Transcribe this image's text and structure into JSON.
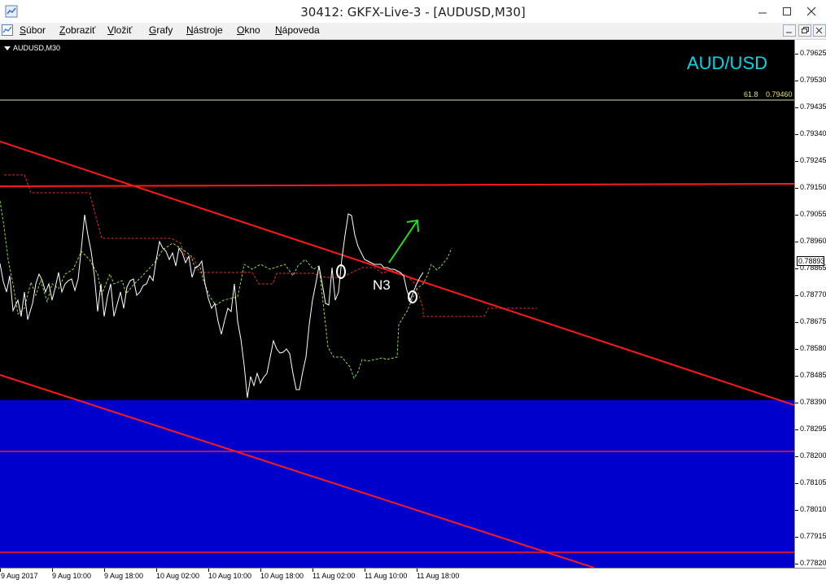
{
  "window": {
    "title": "30412: GKFX-Live-3 - [AUDUSD,M30]"
  },
  "menu": {
    "items": [
      {
        "ul": "S",
        "rest": "úbor"
      },
      {
        "ul": "Z",
        "rest": "obraziť"
      },
      {
        "ul": "V",
        "rest": "ložiť"
      },
      {
        "ul": "G",
        "rest": "rafy"
      },
      {
        "ul": "N",
        "rest": "ástroje"
      },
      {
        "ul": "O",
        "rest": "kno"
      },
      {
        "ul": "N",
        "rest": "ápoveda"
      }
    ]
  },
  "chart": {
    "symbol_label": "AUDUSD,M30",
    "pair_label": "AUD/USD",
    "fib_level": "61.8",
    "fib_price": "0.79460",
    "annotation": "N3",
    "current_price": "0.78893",
    "colors": {
      "background": "#000000",
      "trendline": "#ff1a1a",
      "zone": "#0000cc",
      "price_line": "#ffffff",
      "dashed_green": "#8fd84a",
      "dashed_red": "#e03030",
      "arrow": "#22dd22",
      "fib_line": "#d8d8a0",
      "pair_label": "#00d8e8"
    }
  },
  "price_axis": {
    "labels": [
      "0.79625",
      "0.79530",
      "0.79435",
      "0.79340",
      "0.79245",
      "0.79150",
      "0.79055",
      "0.78960",
      "0.78865",
      "0.78770",
      "0.78675",
      "0.78580",
      "0.78485",
      "0.78390",
      "0.78295",
      "0.78200",
      "0.78105",
      "0.78010",
      "0.77915",
      "0.77820"
    ]
  },
  "time_axis": {
    "labels": [
      "9 Aug 2017",
      "9 Aug 10:00",
      "9 Aug 18:00",
      "10 Aug 02:00",
      "10 Aug 10:00",
      "10 Aug 18:00",
      "11 Aug 02:00",
      "11 Aug 10:00",
      "11 Aug 18:00"
    ]
  }
}
